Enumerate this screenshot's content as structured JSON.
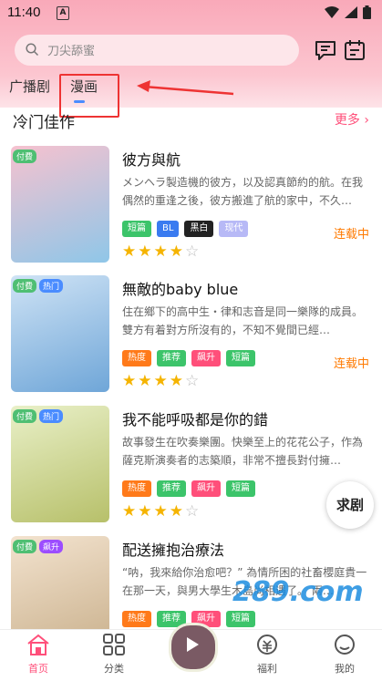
{
  "status_bar": {
    "time": "11:40",
    "sim_label": "A"
  },
  "search": {
    "placeholder": "刀尖舔蜜"
  },
  "tabs": [
    {
      "label": "广播剧"
    },
    {
      "label": "漫画"
    }
  ],
  "section": {
    "title": "冷门佳作",
    "more": "更多 ›"
  },
  "colors": {
    "accent": "#ff4f7a",
    "status": "#ff7a00",
    "star": "#f5b400"
  },
  "items": [
    {
      "title": "彼方與航",
      "desc": "メンヘラ製造機的彼方，以及認真節約的航。在我偶然的重逢之後，彼方搬進了航的家中，不久…",
      "cover_badges": [
        "付費"
      ],
      "tags": [
        {
          "label": "短篇",
          "color": "#3cc46a"
        },
        {
          "label": "BL",
          "color": "#3a7bf0"
        },
        {
          "label": "黑白",
          "color": "#222222"
        },
        {
          "label": "现代",
          "color": "#b7b9f6"
        }
      ],
      "status": "连载中",
      "rating": 4
    },
    {
      "title": "無敵的baby blue",
      "desc": "住在鄉下的高中生・律和志音是同一樂隊的成員。雙方有着對方所沒有的，不知不覺間已經…",
      "cover_badges": [
        "付費",
        "热门"
      ],
      "tags": [
        {
          "label": "热度",
          "color": "#ff7a1a"
        },
        {
          "label": "推荐",
          "color": "#3cc46a"
        },
        {
          "label": "飙升",
          "color": "#ff4f7a"
        },
        {
          "label": "短篇",
          "color": "#3cc46a"
        }
      ],
      "status": "连载中",
      "rating": 4
    },
    {
      "title": "我不能呼吸都是你的錯",
      "desc": "故事發生在吹奏樂團。快樂至上的花花公子，作為薩克斯演奏者的志築順，非常不擅長對付擁…",
      "cover_badges": [
        "付費",
        "热门"
      ],
      "tags": [
        {
          "label": "热度",
          "color": "#ff7a1a"
        },
        {
          "label": "推荐",
          "color": "#3cc46a"
        },
        {
          "label": "飙升",
          "color": "#ff4f7a"
        },
        {
          "label": "短篇",
          "color": "#3cc46a"
        }
      ],
      "status": "",
      "rating": 4
    },
    {
      "title": "配送擁抱治療法",
      "desc": "“呐，我來給你治愈吧？” 為情所困的社畜櫻庭貴一在那一天，與男大學生木島尚相遇了。 兩…",
      "cover_badges": [
        "付費",
        "飙升"
      ],
      "tags": [
        {
          "label": "热度",
          "color": "#ff7a1a"
        },
        {
          "label": "推荐",
          "color": "#3cc46a"
        },
        {
          "label": "飙升",
          "color": "#ff4f7a"
        },
        {
          "label": "短篇",
          "color": "#3cc46a"
        }
      ],
      "status": "",
      "rating": 0
    }
  ],
  "float_button": {
    "label": "求剧"
  },
  "watermark": "289.com",
  "bottom_nav": [
    {
      "label": "首页",
      "icon": "home-icon",
      "active": true
    },
    {
      "label": "分类",
      "icon": "grid-icon"
    },
    {
      "label": "",
      "icon": "play-icon"
    },
    {
      "label": "福利",
      "icon": "gift-icon"
    },
    {
      "label": "我的",
      "icon": "user-icon"
    }
  ]
}
